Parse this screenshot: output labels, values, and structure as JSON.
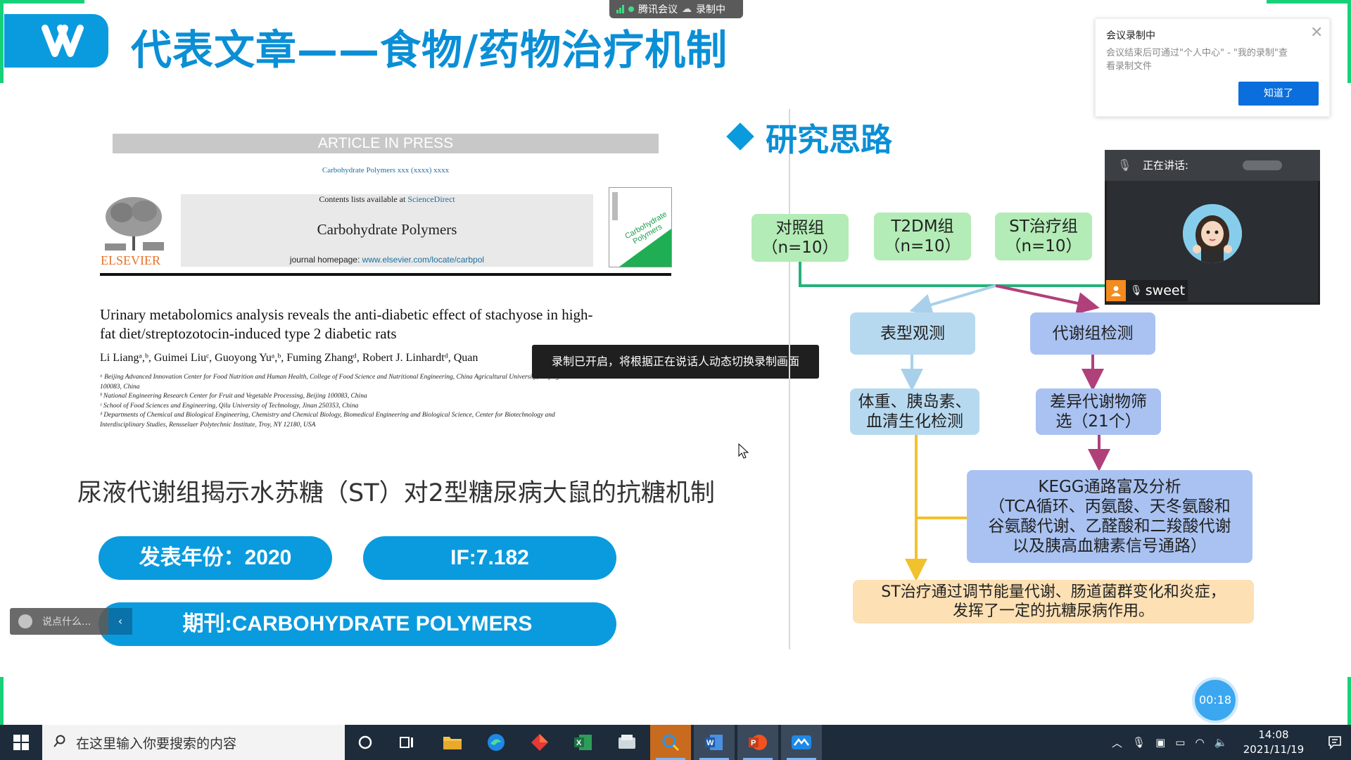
{
  "colors": {
    "accent": "#0a9bde",
    "frame_green": "#17d17a",
    "taskbar": "#1d2b3a"
  },
  "meeting": {
    "app_name": "腾讯会议",
    "recording_status": "录制中",
    "recording_tip": "录制已开启，将根据正在说话人动态切换录制画面"
  },
  "slide": {
    "title": "代表文章——食物/药物治疗机制",
    "paper": {
      "article_in_press": "ARTICLE IN PRESS",
      "journal_ref": "Carbohydrate Polymers xxx (xxxx) xxxx",
      "contents_prefix": "Contents lists available at ",
      "contents_link": "ScienceDirect",
      "journal_name": "Carbohydrate Polymers",
      "homepage_prefix": "journal homepage: ",
      "homepage_link": "www.elsevier.com/locate/carbpol",
      "publisher": "ELSEVIER",
      "cover_text": "Carbohydrate Polymers",
      "title": "Urinary metabolomics analysis reveals the anti-diabetic effect of stachyose in high-fat diet/streptozotocin-induced type 2 diabetic rats",
      "authors": "Li Liangᵃ,ᵇ, Guimei Liuᶜ, Guoyong Yuᵃ,ᵇ, Fuming Zhangᵈ, Robert J. Linhardtᵈ, Quan",
      "affiliations": [
        "ᵃ Beijing Advanced Innovation Center for Food Nutrition and Human Health, College of Food Science and Nutritional Engineering, China Agricultural University, Beijing",
        "100083, China",
        "ᵇ National Engineering Research Center for Fruit and Vegetable Processing, Beijing 100083, China",
        "ᶜ School of Food Sciences and Engineering, Qilu University of Technology, Jinan 250353, China",
        "ᵈ Departments of Chemical and Biological Engineering, Chemistry and Chemical Biology, Biomedical Engineering and Biological Science, Center for Biotechnology and",
        "Interdisciplinary Studies, Rensselaer Polytechnic Institute, Troy, NY 12180, USA"
      ]
    },
    "cn_subtitle": "尿液代谢组揭示水苏糖（ST）对2型糖尿病大鼠的抗糖机制",
    "year_label": "发表年份：2020",
    "if_label": "IF:7.182",
    "journal_label": "期刊:CARBOHYDRATE POLYMERS",
    "research_heading": "研究思路",
    "flow": {
      "control": [
        "对照组",
        "（n=10）"
      ],
      "t2dm": [
        "T2DM组",
        "（n=10）"
      ],
      "st": [
        "ST治疗组",
        "（n=10）"
      ],
      "phenotype": "表型观测",
      "metabolome": "代谢组检测",
      "phenotype_detail": [
        "体重、胰岛素、",
        "血清生化检测"
      ],
      "diff_metab": [
        "差异代谢物筛",
        "选（21个）"
      ],
      "kegg": [
        "KEGG通路富及分析",
        "（TCA循环、丙氨酸、天冬氨酸和",
        "谷氨酸代谢、乙醛酸和二羧酸代谢",
        "以及胰高血糖素信号通路）"
      ],
      "conclusion": [
        "ST治疗通过调节能量代谢、肠道菌群变化和炎症，",
        "发挥了一定的抗糖尿病作用。"
      ]
    }
  },
  "chat": {
    "placeholder": "说点什么..."
  },
  "notification": {
    "title": "会议录制中",
    "body": "会议结束后可通过\"个人中心\" - \"我的录制\"查看录制文件",
    "button": "知道了"
  },
  "video": {
    "speaking_label": "正在讲话:",
    "participant": "sweet"
  },
  "timer": "00:18",
  "taskbar": {
    "search_placeholder": "在这里输入你要搜索的内容",
    "time": "14:08",
    "date": "2021/11/19"
  }
}
